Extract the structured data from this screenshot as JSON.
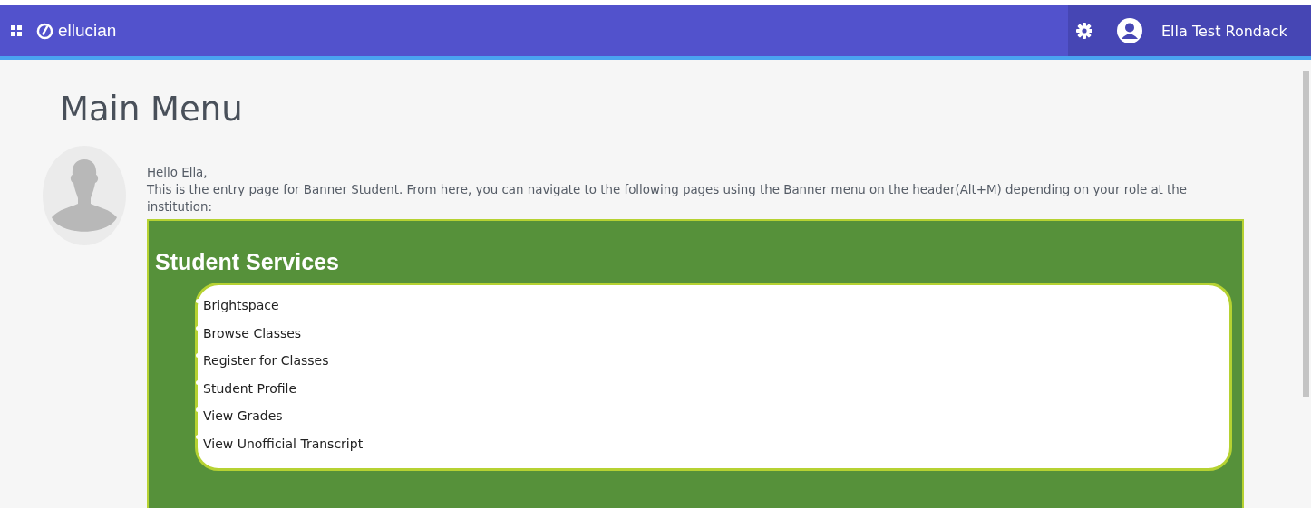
{
  "header": {
    "brand": "ellucian",
    "user_name": "Ella Test Rondack"
  },
  "title": "Main Menu",
  "greeting": "Hello Ella,",
  "intro": "This is the entry page for Banner Student. From here, you can navigate to the following pages using the Banner menu on the header(Alt+M) depending on your role at the institution:",
  "services": {
    "heading": "Student Services",
    "links": [
      "Brightspace",
      "Browse Classes",
      "Register for Classes",
      "Student Profile",
      "View Grades",
      "View Unofficial Transcript"
    ]
  }
}
